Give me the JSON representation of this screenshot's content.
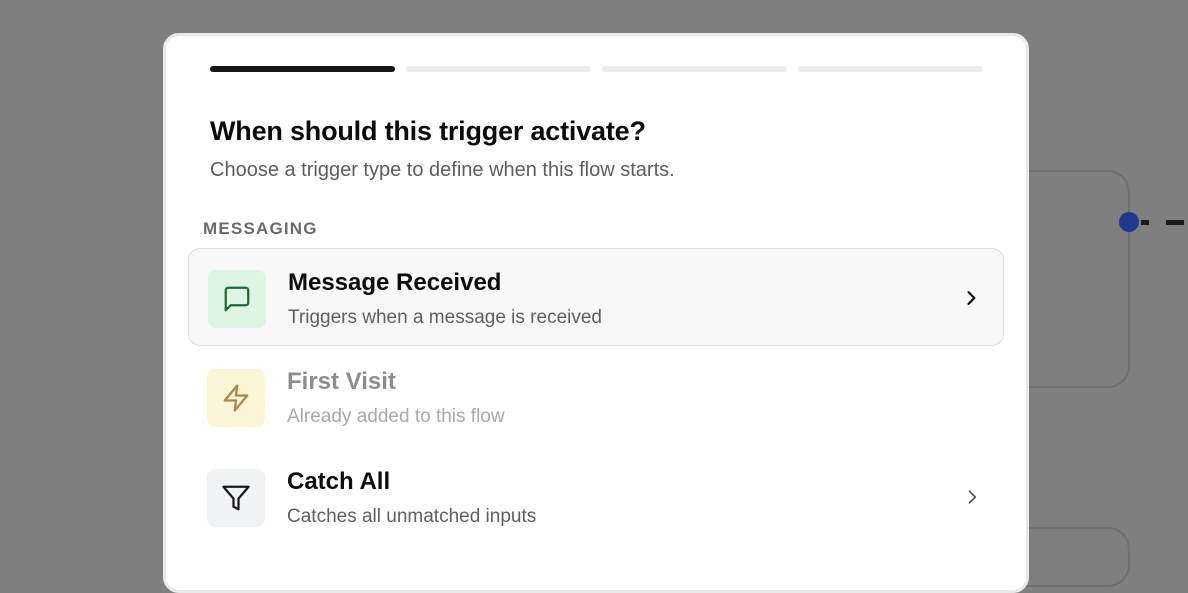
{
  "modal": {
    "progress": {
      "total_steps": 4,
      "current_step": 1
    },
    "title": "When should this trigger activate?",
    "subtitle": "Choose a trigger type to define when this flow starts.",
    "section_label": "MESSAGING",
    "options": [
      {
        "title": "Message Received",
        "description": "Triggers when a message is received",
        "icon": "message-square-icon",
        "icon_color": "#1e6b3a",
        "state": "selected"
      },
      {
        "title": "First Visit",
        "description": "Already added to this flow",
        "icon": "zap-icon",
        "icon_color": "#a8864a",
        "state": "disabled"
      },
      {
        "title": "Catch All",
        "description": "Catches all unmatched inputs",
        "icon": "filter-icon",
        "icon_color": "#1a1a1a",
        "state": "default"
      }
    ]
  },
  "colors": {
    "overlay": "#7f7f7f",
    "progress_active": "#171717",
    "progress_inactive": "#ececec",
    "edge_handle": "#1f3a8a"
  }
}
